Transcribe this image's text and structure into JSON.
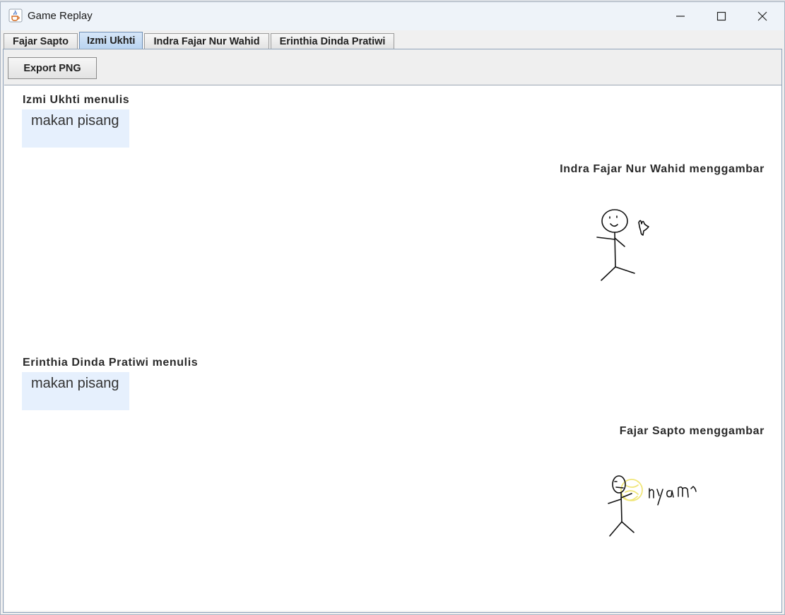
{
  "window": {
    "title": "Game Replay",
    "icon": "java-cup-icon"
  },
  "tabs": [
    {
      "label": "Fajar Sapto",
      "active": false
    },
    {
      "label": "Izmi Ukhti",
      "active": true
    },
    {
      "label": "Indra Fajar Nur Wahid",
      "active": false
    },
    {
      "label": "Erinthia Dinda Pratiwi",
      "active": false
    }
  ],
  "toolbar": {
    "export_label": "Export PNG"
  },
  "replay": {
    "entries": [
      {
        "type": "text",
        "caption": "Izmi Ukhti menulis",
        "text": "makan pisang"
      },
      {
        "type": "drawing",
        "caption": "Indra Fajar Nur Wahid menggambar",
        "drawing": "stick-figure-waving"
      },
      {
        "type": "text",
        "caption": "Erinthia Dinda Pratiwi menulis",
        "text": "makan pisang"
      },
      {
        "type": "drawing",
        "caption": "Fajar Sapto menggambar",
        "drawing": "stick-figure-eating-banana",
        "drawing_text": "nyam"
      }
    ]
  },
  "colors": {
    "tab_active": "#b8d3f0",
    "bubble": "#e6f0fd",
    "banana": "#f3ec8a"
  }
}
